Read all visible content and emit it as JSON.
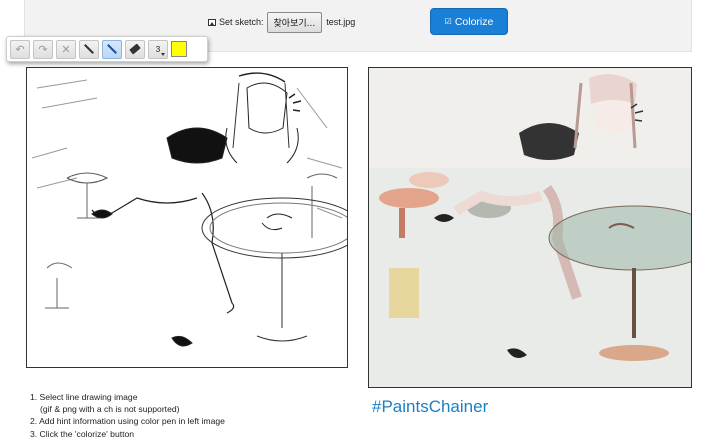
{
  "header": {
    "set_sketch_label": "Set sketch:",
    "file_button_label": "찾아보기...",
    "file_name": "test.jpg",
    "colorize_label": "Colorize",
    "colorize_color": "#1a7fd6"
  },
  "toolbar": {
    "tools": [
      {
        "name": "undo",
        "icon": "undo-icon"
      },
      {
        "name": "redo",
        "icon": "redo-icon"
      },
      {
        "name": "clear",
        "icon": "x-icon"
      },
      {
        "name": "line",
        "icon": "line-icon"
      },
      {
        "name": "pen",
        "icon": "pen-icon",
        "active": true
      },
      {
        "name": "eraser",
        "icon": "eraser-icon"
      }
    ],
    "pen_size": "3",
    "pen_color": "#ffff00"
  },
  "canvas": {
    "left_content": "line drawing of a maid leaning on a café table",
    "right_content": "colorized result of the same drawing"
  },
  "instructions": {
    "lines": [
      "1. Select line drawing image",
      "(gif & png with a ch is not supported)",
      "2. Add hint information using color pen in left image",
      "3. Click the 'colorize' button"
    ]
  },
  "brand": {
    "label": "#PaintsChainer",
    "color": "#1b7fc4"
  }
}
